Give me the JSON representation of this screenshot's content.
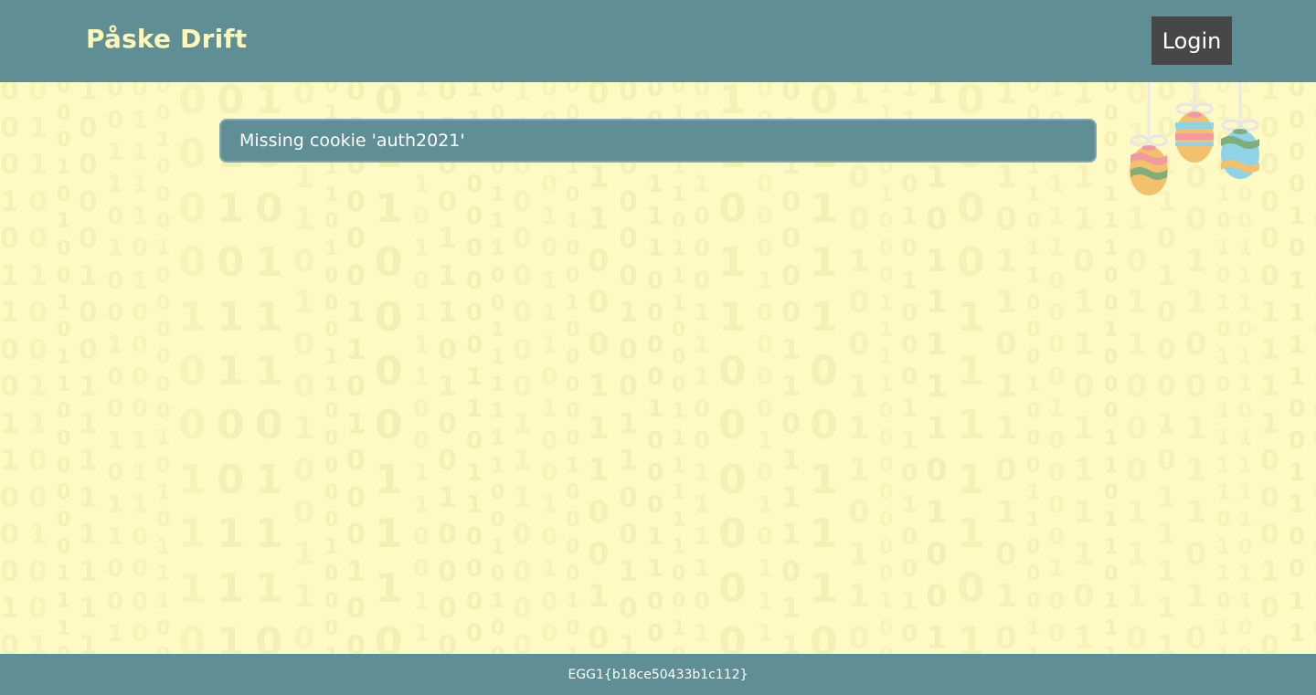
{
  "header": {
    "brand": "Påske Drift",
    "login_label": "Login"
  },
  "alert": {
    "message": "Missing cookie 'auth2021'"
  },
  "footer": {
    "text": "EGG1{b18ce50433b1c112}"
  },
  "decor": {
    "background_pattern": "binary-digits",
    "ornament": "hanging-easter-eggs-icon"
  },
  "colors": {
    "header_bg": "#5f8e94",
    "page_bg": "#fffac4",
    "brand_text": "#fef7b8",
    "login_bg": "#474747",
    "binary_digits": "#f4efb5"
  }
}
